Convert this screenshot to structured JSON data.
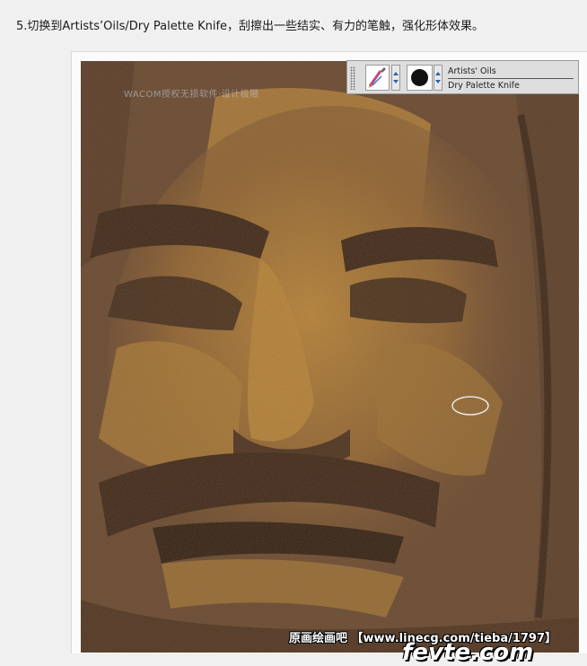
{
  "caption": {
    "text": "5.切换到Artists’Oils/Dry Palette Knife，刮擦出一些结实、有力的笔触，强化形体效果。"
  },
  "toolbar": {
    "brush_category": "Artists' Oils",
    "brush_variant": "Dry Palette Knife",
    "icons": [
      "grip-handle-icon",
      "brush-category-icon",
      "dropdown-arrow-icon",
      "brush-variant-dot-icon",
      "dropdown-arrow-icon"
    ]
  },
  "canvas": {
    "watermark": "WACOM授权无损软件·设计极限",
    "site_line": "原画绘画吧 【www.linecg.com/tieba/1797】",
    "site_logo": "fevte.com",
    "colors": {
      "bg": "#6b4a33",
      "highlight": "#c8913e",
      "dark": "#3a2418",
      "cursor": "#e8e8e8"
    }
  }
}
